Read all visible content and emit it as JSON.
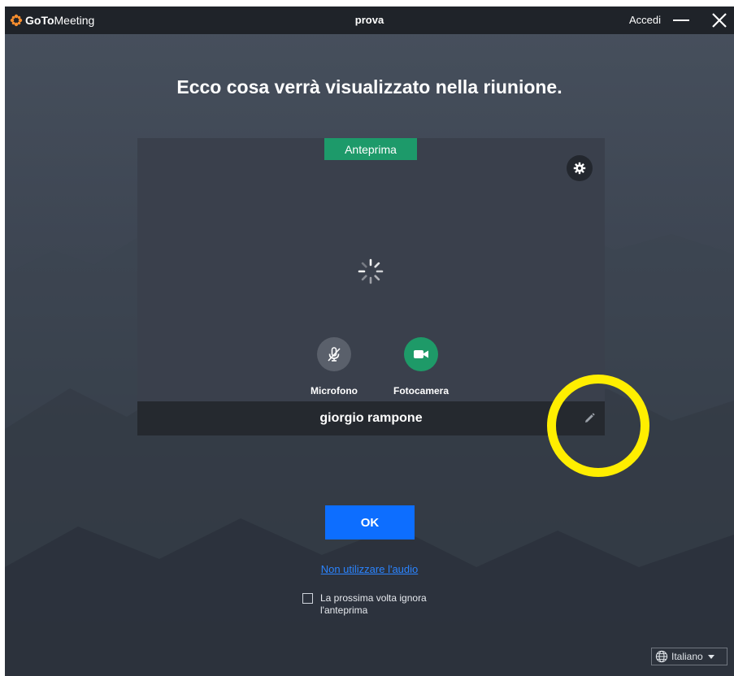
{
  "titlebar": {
    "logo_goto": "GoTo",
    "logo_meeting": "Meeting",
    "title": "prova",
    "accedi": "Accedi"
  },
  "headline": "Ecco cosa verrà visualizzato nella riunione.",
  "preview": {
    "label": "Anteprima",
    "mic_label": "Microfono",
    "cam_label": "Fotocamera",
    "participant_name": "giorgio rampone"
  },
  "actions": {
    "ok": "OK",
    "no_audio": "Non utilizzare l'audio",
    "skip_preview": "La prossima volta ignora l'anteprima"
  },
  "language": "Italiano",
  "colors": {
    "accent_green": "#1e9a68",
    "ok_blue": "#0d6eff",
    "link_blue": "#2b84ff",
    "highlight_yellow": "#ffee00"
  },
  "icons": [
    "goto-logo-icon",
    "minimize-icon",
    "close-icon",
    "settings-gear-icon",
    "loading-spinner-icon",
    "microphone-muted-icon",
    "video-camera-icon",
    "pencil-edit-icon",
    "globe-icon"
  ]
}
